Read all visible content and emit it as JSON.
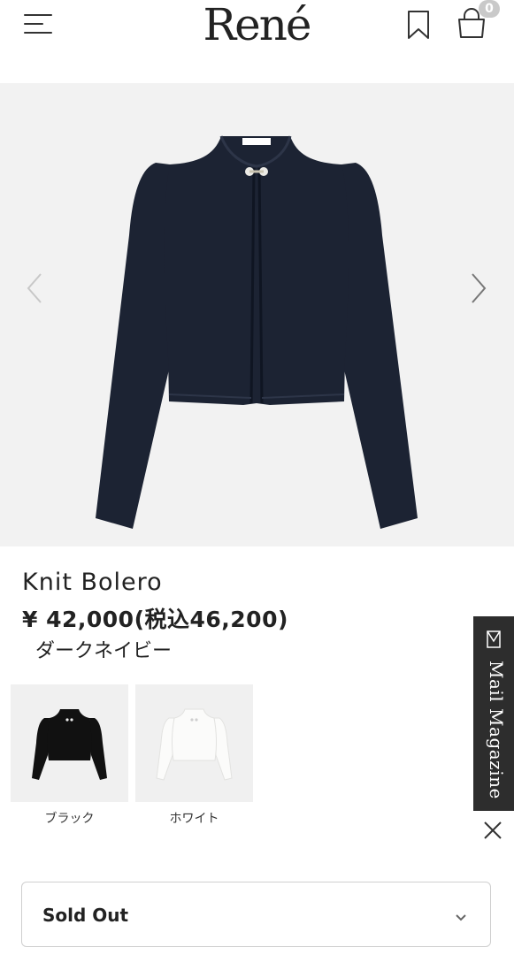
{
  "header": {
    "logo": "René",
    "cart_count": "0",
    "menu_icon": "hamburger-menu-icon",
    "bookmark_icon": "bookmark-icon",
    "bag_icon": "shopping-bag-icon"
  },
  "gallery": {
    "prev_icon": "chevron-left-icon",
    "next_icon": "chevron-right-icon",
    "garment_color": "#1c2333",
    "background": "#f2f2f2"
  },
  "product": {
    "name": "Knit Bolero",
    "price": "¥ 42,000(税込46,200)",
    "color": "ダークネイビー"
  },
  "swatches": [
    {
      "label": "ブラック",
      "color": "#111111"
    },
    {
      "label": "ホワイト",
      "color": "#f7f7f5"
    }
  ],
  "mail_tab": {
    "label": "Mail Magazine",
    "icon": "mail-icon",
    "close_icon": "close-icon"
  },
  "size_select": {
    "value": "Sold Out",
    "icon": "chevron-down-icon"
  }
}
